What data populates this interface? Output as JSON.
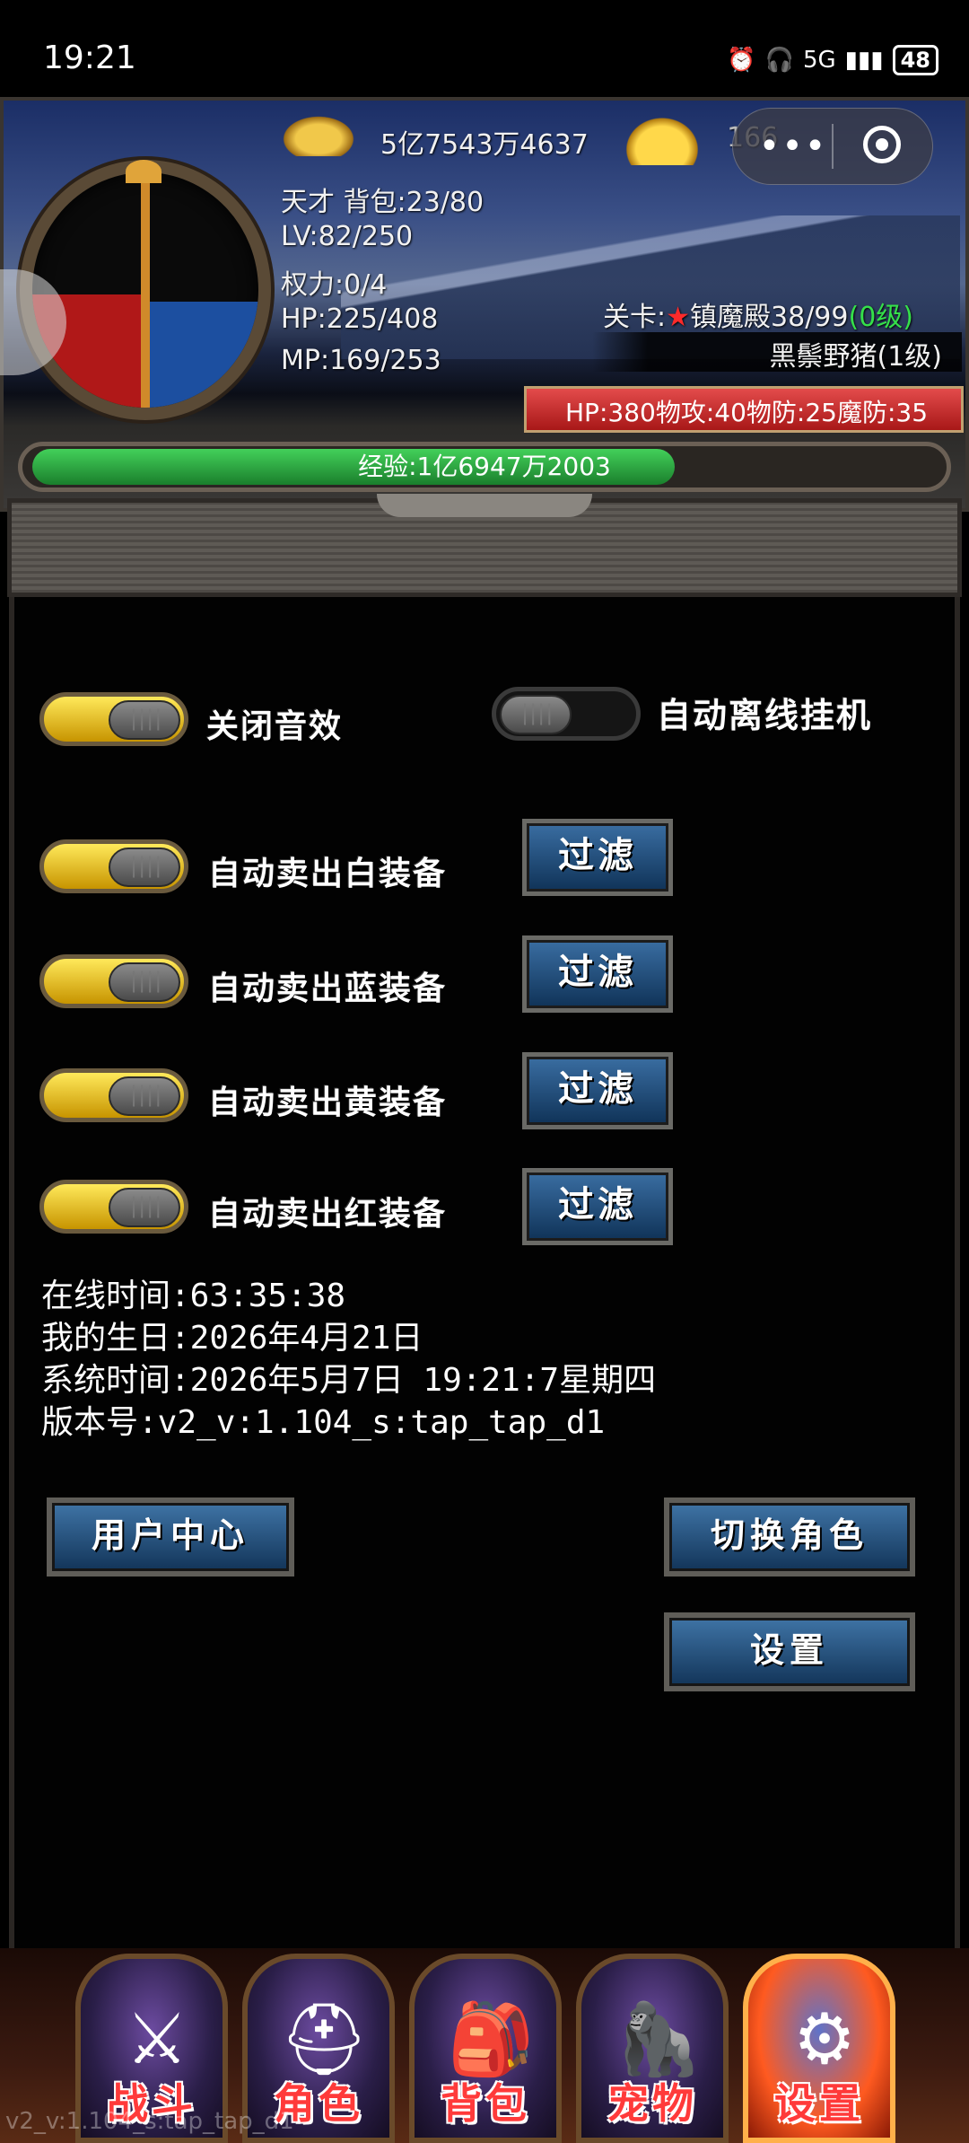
{
  "status_bar": {
    "time": "19:21",
    "network": "5G",
    "battery": "48"
  },
  "hud": {
    "gold": "5亿7543万4637",
    "ingot": "166",
    "title_rank": "天才 背包:23/80",
    "level": "LV:82/250",
    "power": "权力:0/4",
    "hp": "HP:225/408",
    "mp": "MP:169/253",
    "stage_label": "关卡:",
    "stage_star": "★",
    "stage_name": "镇魔殿38/99",
    "stage_grade": "(0级)",
    "monster_name": "黑鬃野猪(1级)",
    "enemy_stats": "HP:380物攻:40物防:25魔防:35",
    "exp_text": "经验:1亿6947万2003",
    "exp_progress": 0.71,
    "orb_hp_fill": 0.48,
    "orb_mp_fill": 0.45
  },
  "settings": {
    "sound_label": "关闭音效",
    "sound_on": true,
    "auto_offline_label": "自动离线挂机",
    "auto_offline_on": false,
    "sell_white_label": "自动卖出白装备",
    "sell_blue_label": "自动卖出蓝装备",
    "sell_yellow_label": "自动卖出黄装备",
    "sell_red_label": "自动卖出红装备",
    "filter_label": "过滤"
  },
  "info": {
    "online_time": "在线时间:63:35:38",
    "birthday": "我的生日:2026年4月21日",
    "system_time": "系统时间:2026年5月7日 19:21:7星期四",
    "version": "版本号:v2_v:1.104_s:tap_tap_d1"
  },
  "buttons": {
    "user_center": "用户中心",
    "switch_role": "切换角色",
    "settings": "设置"
  },
  "nav": {
    "tabs": [
      {
        "label": "战斗",
        "icon": "battle-icon"
      },
      {
        "label": "角色",
        "icon": "helmet-icon"
      },
      {
        "label": "背包",
        "icon": "backpack-icon"
      },
      {
        "label": "宠物",
        "icon": "pet-icon"
      },
      {
        "label": "设置",
        "icon": "gear-icon"
      }
    ],
    "active": 4
  },
  "watermark": "v2_v:1.104_s:tap_tap_d1"
}
